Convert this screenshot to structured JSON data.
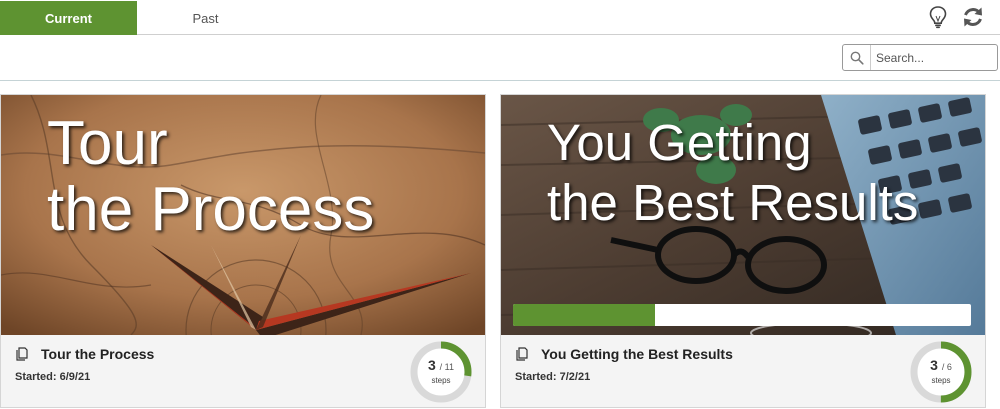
{
  "tabs": [
    {
      "label": "Current",
      "active": true
    },
    {
      "label": "Past",
      "active": false
    }
  ],
  "toolbar": {
    "hint_icon": "lightbulb-icon",
    "refresh_icon": "refresh-icon"
  },
  "search": {
    "placeholder": "Search...",
    "value": "",
    "icon": "search-icon"
  },
  "colors": {
    "accent": "#5e9331",
    "ring_track": "#d9d9d9"
  },
  "cards": [
    {
      "cover_lines": [
        "Tour",
        "the Process"
      ],
      "title": "Tour the Process",
      "started": "Started: 6/9/21",
      "steps_done": "3",
      "steps_total": "/ 11",
      "steps_label": "steps",
      "progress": 0.2727
    },
    {
      "cover_lines": [
        "You Getting",
        "the Best Results"
      ],
      "title": "You Getting the Best Results",
      "started": "Started: 7/2/21",
      "steps_done": "3",
      "steps_total": "/ 6",
      "steps_label": "steps",
      "progress": 0.5,
      "cover_progress": 0.31
    }
  ]
}
